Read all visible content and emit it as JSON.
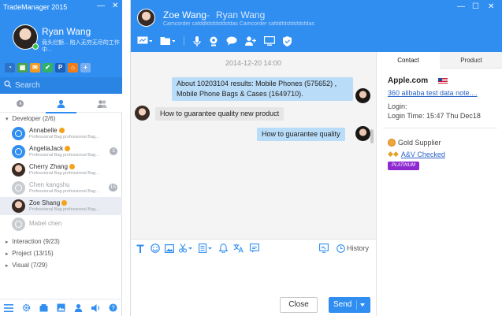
{
  "sidebar": {
    "title": "TradeManager 2015",
    "user": {
      "name": "Ryan Wang",
      "status": "竟头烂额... 陷入无穷无尽的工作中..."
    },
    "search_placeholder": "Search",
    "tabs": [
      "recent",
      "contacts",
      "groups"
    ],
    "groups": [
      {
        "label": "Developer",
        "count": "(2/6)",
        "expanded": true,
        "contacts": [
          {
            "name": "Annabelle",
            "badge": true,
            "sub": "Professional Bag professional Bag...",
            "count": "",
            "online": true
          },
          {
            "name": "AngeliaJack",
            "badge": true,
            "sub": "Professional Bag professional Bag...",
            "count": "3",
            "online": true
          },
          {
            "name": "Cherry Zhang",
            "badge": true,
            "sub": "Professional Bag professional Bag...",
            "count": "",
            "online": true
          },
          {
            "name": "Chen kangshu",
            "badge": false,
            "sub": "Professional Bag professional Bag...",
            "count": "15",
            "online": false
          },
          {
            "name": "Zoe Shang",
            "badge": true,
            "sub": "Professional Bag professional Bag...",
            "count": "",
            "online": true
          },
          {
            "name": "Mabel chen",
            "badge": false,
            "sub": "",
            "count": "",
            "online": false
          }
        ]
      },
      {
        "label": "Interaction",
        "count": "(9/23)",
        "expanded": false
      },
      {
        "label": "Project",
        "count": "(13/15)",
        "expanded": false
      },
      {
        "label": "Visual",
        "count": "(7/29)",
        "expanded": false
      }
    ]
  },
  "chat": {
    "peer": {
      "name": "Zoe Wang",
      "separator": "-",
      "company": "Ryan Wang",
      "status": "Camcorder cafddfdsfdsfdsfdas Camcorder cafddfdsfdsfdsfdas"
    },
    "toolbar": [
      "screen-share",
      "folder",
      "mic",
      "webcam",
      "chat-bubble",
      "add-user",
      "monitor",
      "shield"
    ],
    "timestamp": "2014-12-20  14:00",
    "messages": [
      {
        "from": "me",
        "text_line1": "About 10203104 results: Mobile Phones (575652) ,",
        "text_line2": "Mobile Phone Bags & Cases (1649710)."
      },
      {
        "from": "them",
        "text": "How to guarantee quality new product"
      },
      {
        "from": "me",
        "text": "How to guarantee quality"
      }
    ],
    "compose_tools": [
      "font",
      "emoji",
      "image",
      "cut",
      "template",
      "bell",
      "translate",
      "edit"
    ],
    "history_label": "History",
    "close_label": "Close",
    "send_label": "Send"
  },
  "info": {
    "tabs": [
      "Contact",
      "Product"
    ],
    "active_tab": "Contact",
    "company": "Apple.com",
    "link": "360 alibaba test data note....",
    "login_label": "Login:",
    "login_time": "Login Time: 15:47 Thu Dec18",
    "gold": "Gold Supplier",
    "av_checked": "A&V Checked",
    "platinum": "PLATINUM"
  },
  "colors": {
    "brand_blue": "#2f8ef0",
    "bubble_me": "#b9dcf8",
    "bubble_them": "#e6e6e6"
  }
}
